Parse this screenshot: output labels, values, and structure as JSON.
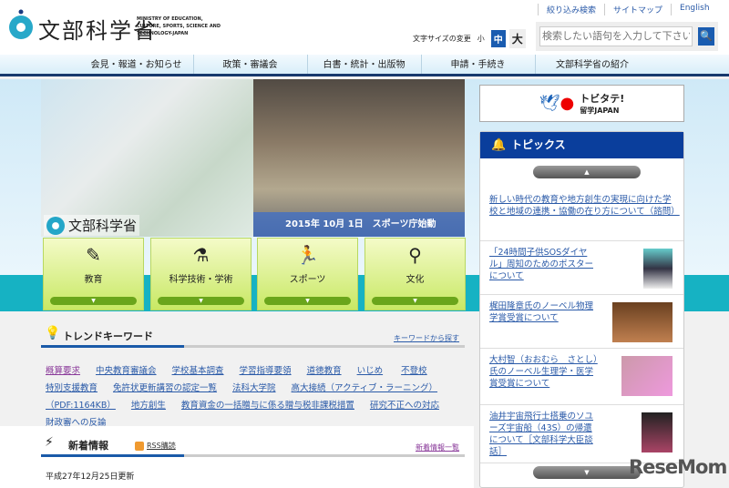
{
  "header": {
    "logo_ja": "文部科学省",
    "logo_en": "MINISTRY OF EDUCATION, CULTURE, SPORTS, SCIENCE AND TECHNOLOGY-JAPAN",
    "top_links": [
      "絞り込み検索",
      "サイトマップ",
      "English"
    ],
    "font_size_label": "文字サイズの変更",
    "font_sizes": [
      "小",
      "中",
      "大"
    ],
    "search_placeholder": "検索したい語句を入力して下さい",
    "search_icon": "🔍"
  },
  "nav": [
    "会見・報道・お知らせ",
    "政策・審議会",
    "白書・統計・出版物",
    "申請・手続き",
    "文部科学省の紹介"
  ],
  "hero": {
    "logo": "文部科学省",
    "caption": "2015年 10月 1日　スポーツ庁始動"
  },
  "tiles": [
    {
      "label": "教育",
      "icon": "✎"
    },
    {
      "label": "科学技術・学術",
      "icon": "⚗"
    },
    {
      "label": "スポーツ",
      "icon": "🏃"
    },
    {
      "label": "文化",
      "icon": "⚲"
    }
  ],
  "trend": {
    "title": "トレンドキーワード",
    "more": "キーワードから探す",
    "keywords": [
      "概算要求",
      "中央教育審議会",
      "学校基本調査",
      "学習指導要領",
      "道徳教育",
      "いじめ",
      "不登校",
      "特別支援教育",
      "免許状更新講習の認定一覧",
      "法科大学院",
      "高大接続（アクティブ・ラーニング）（PDF:1164KB）",
      "地方創生",
      "教育資金の一括贈与に係る贈与税非課税措置",
      "研究不正への対応",
      "財政審への反論"
    ]
  },
  "news": {
    "title": "新着情報",
    "rss": "RSS購読",
    "more": "新着情報一覧",
    "updated": "平成27年12月25日更新"
  },
  "banner": {
    "title": "トビタテ!",
    "sub": "留学JAPAN"
  },
  "topics": {
    "title": "トピックス",
    "items": [
      "新しい時代の教育や地方創生の実現に向けた学校と地域の連携・協働の在り方について（諮問）",
      "「24時間子供SOSダイヤル」周知のためのポスターについて",
      "梶田隆章氏のノーベル物理学賞受賞について",
      "大村智（おおむら　さとし）氏のノーベル生理学・医学賞受賞について",
      "油井宇宙飛行士搭乗のソユーズ宇宙船（43S）の帰還について［文部科学大臣談話］"
    ]
  },
  "watermark": "ReseMom"
}
